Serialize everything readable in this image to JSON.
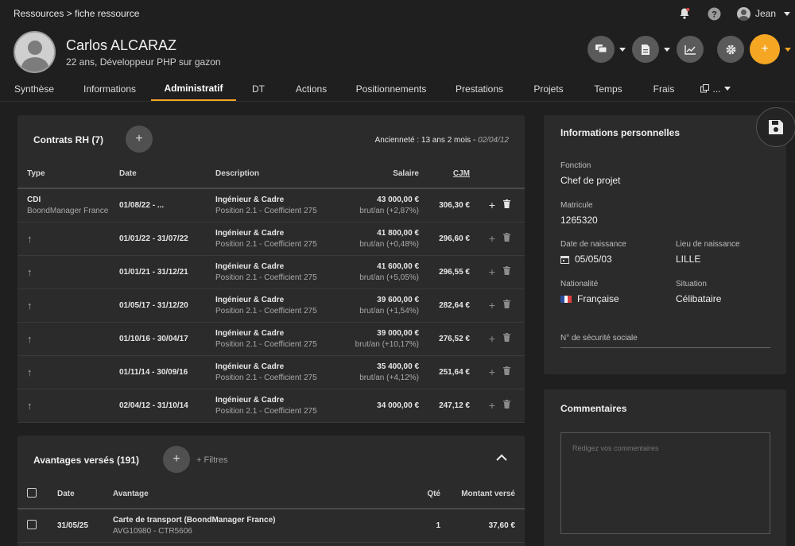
{
  "breadcrumb": "Ressources > fiche ressource",
  "topbar": {
    "user_name": "Jean"
  },
  "profile": {
    "name": "Carlos ALCARAZ",
    "subtitle": "22 ans, Développeur PHP sur gazon",
    "add_label": "+"
  },
  "tabs": [
    "Synthèse",
    "Informations",
    "Administratif",
    "DT",
    "Actions",
    "Positionnements",
    "Prestations",
    "Projets",
    "Temps",
    "Frais",
    "..."
  ],
  "active_tab": "Administratif",
  "contracts": {
    "title": "Contrats RH (7)",
    "seniority": "Ancienneté : 13 ans 2 mois - ",
    "seniority_date": "02/04/12",
    "add_label": "+",
    "columns": {
      "type": "Type",
      "date": "Date",
      "description": "Description",
      "salary": "Salaire",
      "cjm": "CJM"
    },
    "rows": [
      {
        "type": "CDI",
        "company": "BoondManager France",
        "date": "01/08/22 - ...",
        "desc1": "Ingénieur & Cadre",
        "desc2": "Position 2.1 - Coefficient 275",
        "salary": "43 000,00 €",
        "salary_sub": "brut/an (+2,87%)",
        "cjm": "306,30 €"
      },
      {
        "type": "↑",
        "company": "",
        "date": "01/01/22 - 31/07/22",
        "desc1": "Ingénieur & Cadre",
        "desc2": "Position 2.1 - Coefficient 275",
        "salary": "41 800,00 €",
        "salary_sub": "brut/an (+0,48%)",
        "cjm": "296,60 €"
      },
      {
        "type": "↑",
        "company": "",
        "date": "01/01/21 - 31/12/21",
        "desc1": "Ingénieur & Cadre",
        "desc2": "Position 2.1 - Coefficient 275",
        "salary": "41 600,00 €",
        "salary_sub": "brut/an (+5,05%)",
        "cjm": "296,55 €"
      },
      {
        "type": "↑",
        "company": "",
        "date": "01/05/17 - 31/12/20",
        "desc1": "Ingénieur & Cadre",
        "desc2": "Position 2.1 - Coefficient 275",
        "salary": "39 600,00 €",
        "salary_sub": "brut/an (+1,54%)",
        "cjm": "282,64 €"
      },
      {
        "type": "↑",
        "company": "",
        "date": "01/10/16 - 30/04/17",
        "desc1": "Ingénieur & Cadre",
        "desc2": "Position 2.1 - Coefficient 275",
        "salary": "39 000,00 €",
        "salary_sub": "brut/an (+10,17%)",
        "cjm": "276,52 €"
      },
      {
        "type": "↑",
        "company": "",
        "date": "01/11/14 - 30/09/16",
        "desc1": "Ingénieur & Cadre",
        "desc2": "Position 2.1 - Coefficient 275",
        "salary": "35 400,00 €",
        "salary_sub": "brut/an (+4,12%)",
        "cjm": "251,64 €"
      },
      {
        "type": "↑",
        "company": "",
        "date": "02/04/12 - 31/10/14",
        "desc1": "Ingénieur & Cadre",
        "desc2": "Position 2.1 - Coefficient 275",
        "salary": "34 000,00 €",
        "salary_sub": "",
        "cjm": "247,12 €"
      }
    ]
  },
  "benefits": {
    "title": "Avantages versés (191)",
    "add_label": "+",
    "filters_label": "+ Filtres",
    "columns": {
      "date": "Date",
      "benefit": "Avantage",
      "qty": "Qté",
      "amount": "Montant versé"
    },
    "rows": [
      {
        "date": "31/05/25",
        "benefit": "Carte de transport (BoondManager France)",
        "ref": "AVG10980 - CTR5606",
        "qty": "1",
        "amount": "37,60 €"
      }
    ]
  },
  "personal": {
    "title": "Informations personnelles",
    "function_label": "Fonction",
    "function_value": "Chef de projet",
    "matricule_label": "Matricule",
    "matricule_value": "1265320",
    "birthdate_label": "Date de naissance",
    "birthdate_value": "05/05/03",
    "birthplace_label": "Lieu de naissance",
    "birthplace_value": "LILLE",
    "nationality_label": "Nationalité",
    "nationality_value": "Française",
    "situation_label": "Situation",
    "situation_value": "Célibataire",
    "ssn_label": "N° de sécurité sociale"
  },
  "comments": {
    "title": "Commentaires",
    "placeholder": "Rédigez vos commentaires"
  },
  "colors": {
    "accent": "#f5a623",
    "background": "#1f1f1f",
    "card": "#2b2b2b"
  }
}
